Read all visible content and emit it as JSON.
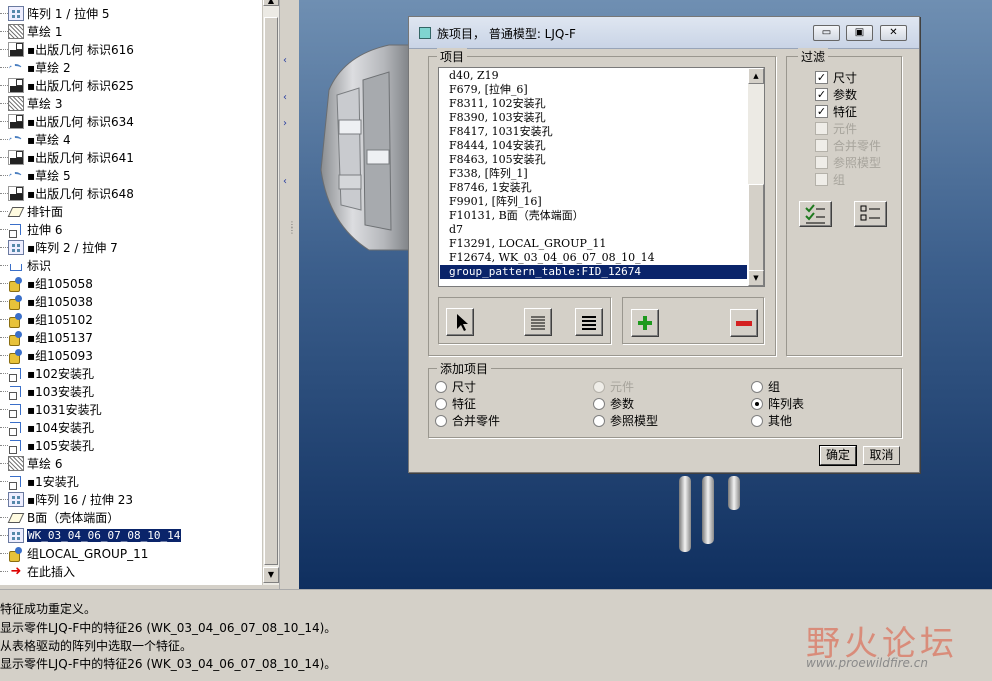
{
  "model_tree": {
    "items": [
      {
        "icon": "pattern-icon",
        "label": "阵列 1 / 拉伸 5"
      },
      {
        "icon": "sketch-icon",
        "label": "草绘 1"
      },
      {
        "icon": "publish-geometry-icon",
        "label": "▪出版几何 标识616"
      },
      {
        "icon": "curve-icon",
        "label": "▪草绘 2"
      },
      {
        "icon": "publish-geometry-icon",
        "label": "▪出版几何 标识625"
      },
      {
        "icon": "sketch-icon",
        "label": "草绘 3"
      },
      {
        "icon": "publish-geometry-icon",
        "label": "▪出版几何 标识634"
      },
      {
        "icon": "curve-icon",
        "label": "▪草绘 4"
      },
      {
        "icon": "publish-geometry-icon",
        "label": "▪出版几何 标识641"
      },
      {
        "icon": "curve-icon",
        "label": "▪草绘 5"
      },
      {
        "icon": "publish-geometry-icon",
        "label": "▪出版几何 标识648"
      },
      {
        "icon": "plane-icon",
        "label": "排针面"
      },
      {
        "icon": "extrude-icon",
        "label": "拉伸 6"
      },
      {
        "icon": "pattern-icon",
        "label": "▪阵列 2 / 拉伸 7"
      },
      {
        "icon": "mark-icon",
        "label": "标识"
      },
      {
        "icon": "group-icon",
        "label": "▪组105058"
      },
      {
        "icon": "group-icon",
        "label": "▪组105038"
      },
      {
        "icon": "group-icon",
        "label": "▪组105102"
      },
      {
        "icon": "group-icon",
        "label": "▪组105137"
      },
      {
        "icon": "group-icon",
        "label": "▪组105093"
      },
      {
        "icon": "hole-icon",
        "label": "▪102安装孔"
      },
      {
        "icon": "hole-icon",
        "label": "▪103安装孔"
      },
      {
        "icon": "hole-icon",
        "label": "▪1031安装孔"
      },
      {
        "icon": "hole-icon",
        "label": "▪104安装孔"
      },
      {
        "icon": "hole-icon",
        "label": "▪105安装孔"
      },
      {
        "icon": "sketch-icon",
        "label": "草绘 6"
      },
      {
        "icon": "hole-icon",
        "label": "▪1安装孔"
      },
      {
        "icon": "pattern-icon",
        "label": "▪阵列 16 / 拉伸 23"
      },
      {
        "icon": "plane-icon",
        "label": "B面（壳体端面）"
      },
      {
        "icon": "pattern-icon",
        "label": "WK_03_04_06_07_08_10_14",
        "selected": true
      },
      {
        "icon": "group-icon",
        "label": "组LOCAL_GROUP_11"
      },
      {
        "icon": "insert-here-arrow-icon",
        "label": "在此插入"
      }
    ]
  },
  "dialog": {
    "title": "族项目，  普通模型: LJQ-F",
    "items_group_label": "项目",
    "items": [
      "d40, Z19",
      "F679, [拉伸_6]",
      "F8311, 102安装孔",
      "F8390, 103安装孔",
      "F8417, 1031安装孔",
      "F8444, 104安装孔",
      "F8463, 105安装孔",
      "F338, [阵列_1]",
      "F8746, 1安装孔",
      "F9901, [阵列_16]",
      "F10131, B面（壳体端面）",
      "d7",
      "F13291, LOCAL_GROUP_11",
      "F12674, WK_03_04_06_07_08_10_14",
      "group_pattern_table:FID_12674"
    ],
    "selected_item_index": 14,
    "filter_group_label": "过滤",
    "filters": [
      {
        "label": "尺寸",
        "checked": true,
        "enabled": true
      },
      {
        "label": "参数",
        "checked": true,
        "enabled": true
      },
      {
        "label": "特征",
        "checked": true,
        "enabled": true
      },
      {
        "label": "元件",
        "checked": false,
        "enabled": false
      },
      {
        "label": "合并零件",
        "checked": false,
        "enabled": false
      },
      {
        "label": "参照模型",
        "checked": false,
        "enabled": false
      },
      {
        "label": "组",
        "checked": false,
        "enabled": false
      }
    ],
    "add_group_label": "添加项目",
    "add_options": [
      {
        "label": "尺寸",
        "selected": false,
        "enabled": true
      },
      {
        "label": "元件",
        "selected": false,
        "enabled": false
      },
      {
        "label": "组",
        "selected": false,
        "enabled": true
      },
      {
        "label": "特征",
        "selected": false,
        "enabled": true
      },
      {
        "label": "参数",
        "selected": false,
        "enabled": true
      },
      {
        "label": "阵列表",
        "selected": true,
        "enabled": true
      },
      {
        "label": "合并零件",
        "selected": false,
        "enabled": true
      },
      {
        "label": "参照模型",
        "selected": false,
        "enabled": true
      },
      {
        "label": "其他",
        "selected": false,
        "enabled": true
      }
    ],
    "ok_label": "确定",
    "cancel_label": "取消"
  },
  "messages": [
    "特征成功重定义。",
    "显示零件LJQ-F中的特征26 (WK_03_04_06_07_08_10_14)。",
    "从表格驱动的阵列中选取一个特征。",
    "显示零件LJQ-F中的特征26 (WK_03_04_06_07_08_10_14)。"
  ],
  "watermark": {
    "text": "野火论坛",
    "url": "www.proewildfire.cn"
  },
  "colors": {
    "selection": "#0a246a",
    "viewport_bottom": "#0f2f5f",
    "add_icon": "#1e9a1e",
    "remove_icon": "#d42020",
    "watermark": "#d98c7a"
  }
}
